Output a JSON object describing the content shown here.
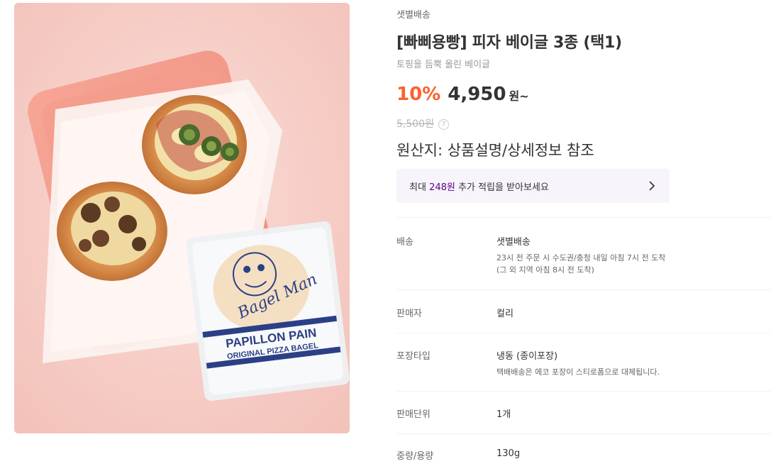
{
  "product": {
    "delivery_tag": "샛별배송",
    "title": "[빠삐용빵] 피자 베이글 3종 (택1)",
    "subtitle": "토핑을 듬뿍 올린 베이글",
    "discount": "10%",
    "price": "4,950",
    "price_unit": "원~",
    "original_price": "5,500원",
    "help_icon": "?",
    "origin": "원산지: 상품설명/상세정보 참조"
  },
  "points": {
    "prefix": "최대 ",
    "amount": "248원",
    "suffix": " 추가 적립을 받아보세요",
    "icon": "chevron-right-icon",
    "amount_color": "#5f0080"
  },
  "details": [
    {
      "label": "배송",
      "value": "샛별배송",
      "sub": [
        "23시 전 주문 시 수도권/충청 내일 아침 7시 전 도착",
        "(그 외 지역 아침 8시 전 도착)"
      ]
    },
    {
      "label": "판매자",
      "value": "컬리",
      "sub": []
    },
    {
      "label": "포장타입",
      "value": "냉동 (종이포장)",
      "sub": [
        "택배배송은 에코 포장이 스티로폼으로 대체됩니다."
      ]
    },
    {
      "label": "판매단위",
      "value": "1개",
      "sub": []
    },
    {
      "label": "중량/용량",
      "value": "130g",
      "sub": []
    }
  ],
  "image": {
    "package_text_1": "PAPILLON PAIN",
    "package_text_2": "ORIGINAL PIZZA BAGEL",
    "package_script": "Bagel Man"
  },
  "colors": {
    "discount": "#fa622f",
    "accent": "#5f0080",
    "points_bg": "#f7f4fb"
  }
}
